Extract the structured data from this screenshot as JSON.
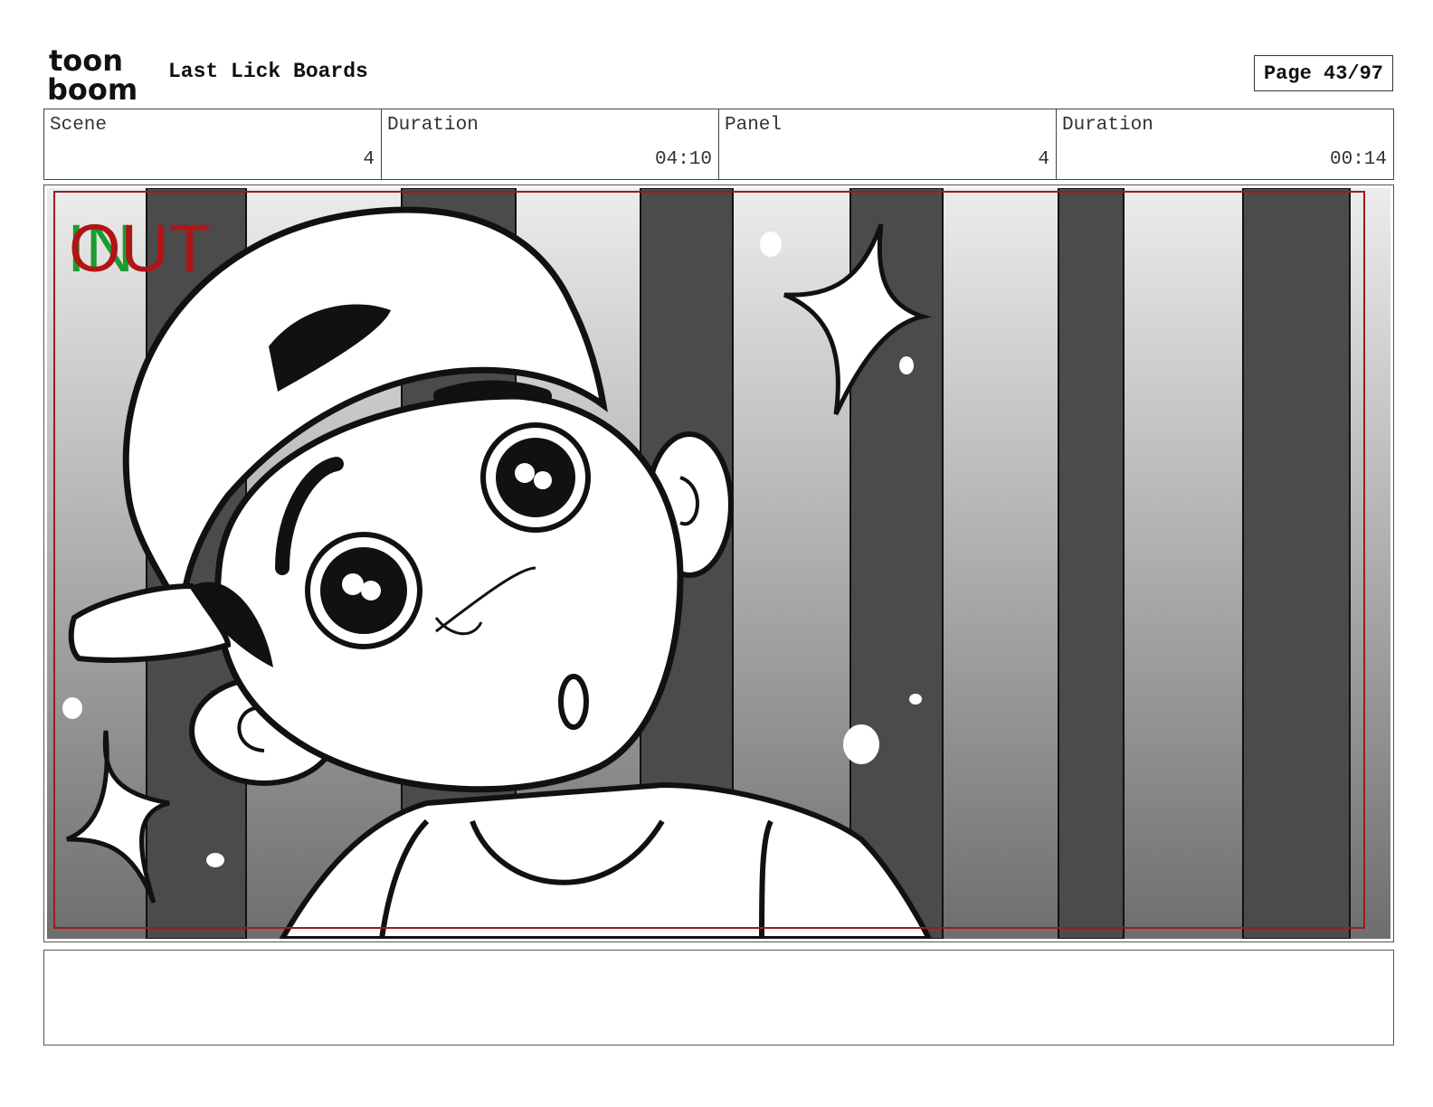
{
  "header": {
    "logo_top": "toon",
    "logo_bottom": "boom",
    "project_title": "Last Lick Boards",
    "page_label": "Page 43/97"
  },
  "info": {
    "scene_label": "Scene",
    "scene_value": "4",
    "scene_duration_label": "Duration",
    "scene_duration_value": "04:10",
    "panel_label": "Panel",
    "panel_value": "4",
    "panel_duration_label": "Duration",
    "panel_duration_value": "00:14"
  },
  "frame": {
    "overlay_in": "IN",
    "overlay_out": "OUT",
    "in_color": "#1a9c2e",
    "out_color": "#b01515",
    "safe_frame_color": "#9b1c1c"
  },
  "notes": {
    "text": ""
  }
}
